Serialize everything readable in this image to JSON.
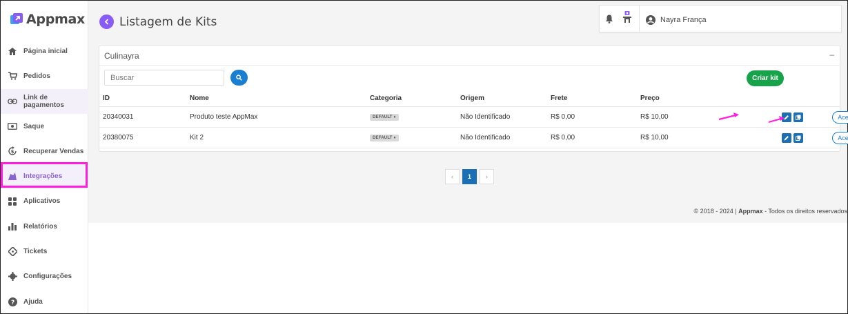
{
  "app": {
    "name": "Appmax"
  },
  "sidebar": {
    "items": [
      {
        "label": "Página inicial",
        "icon": "home-icon"
      },
      {
        "label": "Pedidos",
        "icon": "cart-icon"
      },
      {
        "label": "Link de pagamentos",
        "icon": "link-icon"
      },
      {
        "label": "Saque",
        "icon": "money-icon"
      },
      {
        "label": "Recuperar Vendas",
        "icon": "recover-icon"
      },
      {
        "label": "Integrações",
        "icon": "puzzle-icon"
      },
      {
        "label": "Aplicativos",
        "icon": "apps-grid-icon"
      },
      {
        "label": "Relatórios",
        "icon": "bar-chart-icon"
      },
      {
        "label": "Tickets",
        "icon": "ticket-icon"
      },
      {
        "label": "Configurações",
        "icon": "gear-icon"
      },
      {
        "label": "Ajuda",
        "icon": "help-icon"
      }
    ],
    "active": "Integrações"
  },
  "header": {
    "title": "Listagem de Kits",
    "user_name": "Nayra França"
  },
  "card": {
    "title": "Culinayra",
    "collapse_symbol": "–",
    "search_placeholder": "Buscar",
    "create_label": "Criar kit"
  },
  "table": {
    "columns": [
      "ID",
      "Nome",
      "Categoria",
      "Origem",
      "Frete",
      "Preço"
    ],
    "rows": [
      {
        "id": "20340031",
        "nome": "Produto teste AppMax",
        "categoria": "DEFAULT",
        "origem": "Não Identificado",
        "frete": "R$ 0,00",
        "preco": "R$ 10,00",
        "link_label": "Acessar Link"
      },
      {
        "id": "20380075",
        "nome": "Kit 2",
        "categoria": "DEFAULT",
        "origem": "Não Identificado",
        "frete": "R$ 0,00",
        "preco": "R$ 10,00",
        "link_label": "Acessar Link"
      }
    ]
  },
  "pagination": {
    "prev": "‹",
    "current": "1",
    "next": "›"
  },
  "footer": {
    "prefix": "© 2018 - 2024 |",
    "brand": "Appmax",
    "suffix": " - Todos os direitos reservados"
  },
  "colors": {
    "accent_purple": "#8a5cf6",
    "primary_blue": "#1b7fd1",
    "success_green": "#17a34a",
    "annotation_magenta": "#ff1ee0"
  }
}
